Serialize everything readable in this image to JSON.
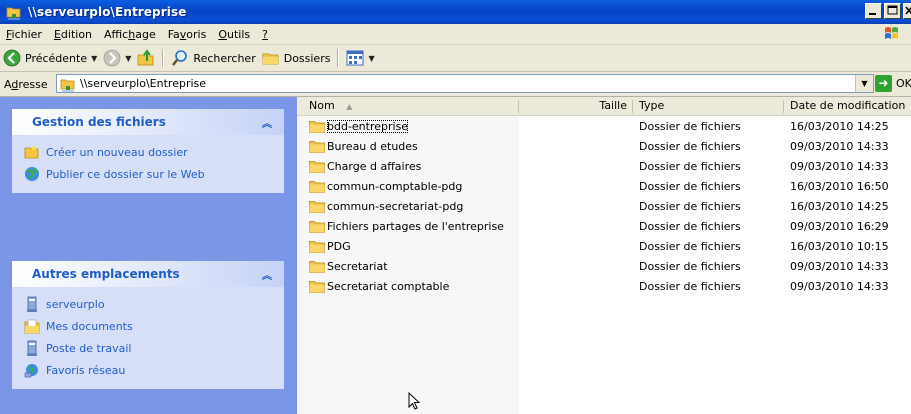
{
  "window": {
    "title": "\\\\serveurplo\\Entreprise",
    "controls": [
      "minimize",
      "maximize",
      "close"
    ]
  },
  "menu": {
    "items": [
      {
        "label": "Fichier",
        "key": "F",
        "rest": "ichier"
      },
      {
        "label": "Edition",
        "key": "E",
        "rest": "dition"
      },
      {
        "label": "Affichage",
        "pre": "Affic",
        "key": "h",
        "rest": "age"
      },
      {
        "label": "Favoris",
        "pre": "Fa",
        "key": "v",
        "rest": "oris"
      },
      {
        "label": "Outils",
        "key": "O",
        "rest": "utils"
      },
      {
        "label": "?",
        "key": "?",
        "rest": ""
      }
    ]
  },
  "toolbar": {
    "back_label": "Précédente",
    "search_label": "Rechercher",
    "folders_label": "Dossiers"
  },
  "address": {
    "label": "Adresse",
    "label_pre": "A",
    "label_key": "d",
    "label_rest": "resse",
    "value": "\\\\serveurplo\\Entreprise",
    "go_label": "OK"
  },
  "tasks": {
    "file_panel": {
      "title": "Gestion des fichiers",
      "items": [
        "Créer un nouveau dossier",
        "Publier ce dossier sur le Web"
      ]
    },
    "places_panel": {
      "title": "Autres emplacements",
      "items": [
        "serveurplo",
        "Mes documents",
        "Poste de travail",
        "Favoris réseau"
      ]
    }
  },
  "filelist": {
    "columns": {
      "name": "Nom",
      "size": "Taille",
      "type": "Type",
      "date": "Date de modification"
    },
    "rows": [
      {
        "name": "bdd-entreprise",
        "type": "Dossier de fichiers",
        "date": "16/03/2010 14:25"
      },
      {
        "name": "Bureau d etudes",
        "type": "Dossier de fichiers",
        "date": "09/03/2010 14:33"
      },
      {
        "name": "Charge d affaires",
        "type": "Dossier de fichiers",
        "date": "09/03/2010 14:33"
      },
      {
        "name": "commun-comptable-pdg",
        "type": "Dossier de fichiers",
        "date": "16/03/2010 16:50"
      },
      {
        "name": "commun-secretariat-pdg",
        "type": "Dossier de fichiers",
        "date": "16/03/2010 14:25"
      },
      {
        "name": "Fichiers partages de l'entreprise",
        "type": "Dossier de fichiers",
        "date": "09/03/2010 16:29"
      },
      {
        "name": "PDG",
        "type": "Dossier de fichiers",
        "date": "16/03/2010 10:15"
      },
      {
        "name": "Secretariat",
        "type": "Dossier de fichiers",
        "date": "09/03/2010 14:33"
      },
      {
        "name": "Secretariat comptable",
        "type": "Dossier de fichiers",
        "date": "09/03/2010 14:33"
      }
    ]
  },
  "colors": {
    "titlebar": "#0843c6",
    "task_link": "#215dc6",
    "left_pane": "#7b96e6",
    "chrome": "#ece9d8"
  }
}
